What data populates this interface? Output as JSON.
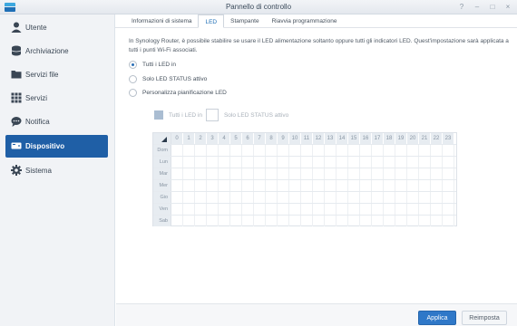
{
  "window": {
    "title": "Pannello di controllo",
    "controls": [
      "?",
      "–",
      "□",
      "×"
    ]
  },
  "sidebar": {
    "items": [
      {
        "label": "Utente",
        "icon": "user-icon",
        "active": false
      },
      {
        "label": "Archiviazione",
        "icon": "storage-icon",
        "active": false
      },
      {
        "label": "Servizi file",
        "icon": "folder-icon",
        "active": false
      },
      {
        "label": "Servizi",
        "icon": "grid-icon",
        "active": false
      },
      {
        "label": "Notifica",
        "icon": "chat-icon",
        "active": false
      },
      {
        "label": "Dispositivo",
        "icon": "device-icon",
        "active": true
      },
      {
        "label": "Sistema",
        "icon": "gear-icon",
        "active": false
      }
    ]
  },
  "tabs": [
    {
      "label": "Informazioni di sistema",
      "active": false
    },
    {
      "label": "LED",
      "active": true
    },
    {
      "label": "Stampante",
      "active": false
    },
    {
      "label": "Riavvia programmazione",
      "active": false
    }
  ],
  "main": {
    "description": "In Synology Router, è possibile stabilire se usare il LED alimentazione soltanto oppure tutti gli indicatori LED. Quest'impostazione sarà applicata a tutti i punti Wi-Fi associati.",
    "options": [
      {
        "label": "Tutti i LED in",
        "selected": true
      },
      {
        "label": "Solo LED STATUS attivo",
        "selected": false
      },
      {
        "label": "Personalizza pianificazione LED",
        "selected": false
      }
    ],
    "legend": {
      "all_label": "Tutti i LED in",
      "status_label": "Solo LED STATUS attivo"
    },
    "schedule": {
      "hours": [
        "0",
        "1",
        "2",
        "3",
        "4",
        "5",
        "6",
        "7",
        "8",
        "9",
        "10",
        "11",
        "12",
        "13",
        "14",
        "15",
        "16",
        "17",
        "18",
        "19",
        "20",
        "21",
        "22",
        "23"
      ],
      "days": [
        "Dom",
        "Lun",
        "Mar",
        "Mer",
        "Gio",
        "Ven",
        "Sab"
      ]
    }
  },
  "footer": {
    "apply_label": "Applica",
    "reset_label": "Reimposta"
  },
  "colors": {
    "accent": "#1f5fa6",
    "primary_button": "#2f78c8"
  }
}
